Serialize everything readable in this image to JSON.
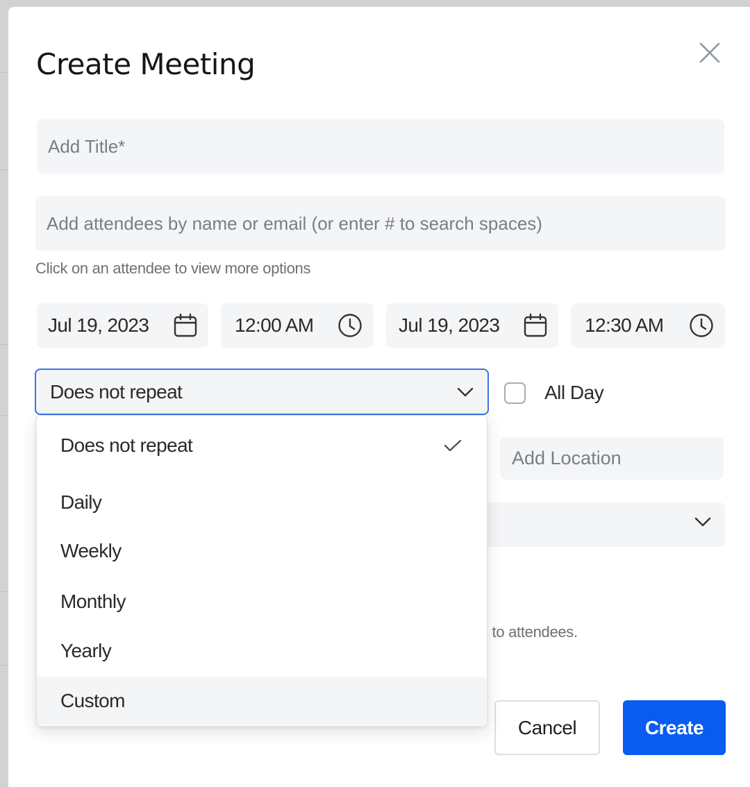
{
  "dialog": {
    "title": "Create Meeting",
    "close_icon": "close-icon"
  },
  "form": {
    "title_placeholder": "Add Title*",
    "attendees_placeholder": "Add attendees by name or email (or enter # to search spaces)",
    "attendees_hint": "Click on an attendee to view more options",
    "start_date": "Jul 19, 2023",
    "start_time": "12:00 AM",
    "end_date": "Jul 19, 2023",
    "end_time": "12:30 AM",
    "date_icon": "calendar-icon",
    "time_icon": "clock-icon",
    "repeat": {
      "selected": "Does not repeat",
      "expanded": true,
      "options": [
        {
          "label": "Does not repeat",
          "selected": true
        },
        {
          "label": "Daily",
          "selected": false
        },
        {
          "label": "Weekly",
          "selected": false
        },
        {
          "label": "Monthly",
          "selected": false
        },
        {
          "label": "Yearly",
          "selected": false
        },
        {
          "label": "Custom",
          "selected": false,
          "hovered": true
        }
      ]
    },
    "all_day_label": "All Day",
    "all_day_checked": false,
    "location_placeholder": "Add Location",
    "notice_fragment": "s to attendees."
  },
  "actions": {
    "cancel_label": "Cancel",
    "create_label": "Create"
  },
  "colors": {
    "primary": "#0a5cf0",
    "focus_border": "#3b73ea",
    "field_bg": "#f4f5f7"
  }
}
